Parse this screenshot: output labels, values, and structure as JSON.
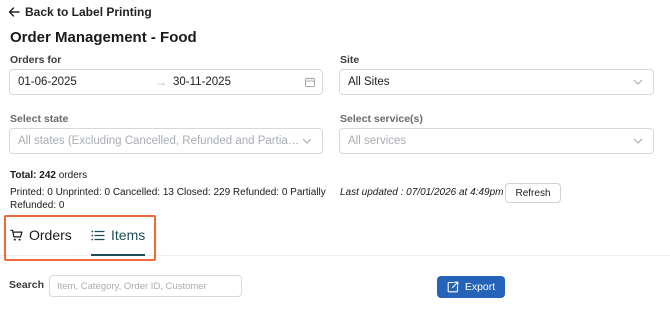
{
  "header": {
    "back_label": "Back to Label Printing",
    "title": "Order Management - Food"
  },
  "filters": {
    "orders_for_label": "Orders for",
    "date_start": "01-06-2025",
    "date_separator": "→",
    "date_end": "30-11-2025",
    "site_label": "Site",
    "site_value": "All Sites",
    "state_label": "Select state",
    "state_placeholder": "All states (Excluding Cancelled, Refunded and Partially ...",
    "service_label": "Select service(s)",
    "service_placeholder": "All services"
  },
  "summary": {
    "total_prefix": "Total:",
    "total_count": "242",
    "total_suffix": "orders",
    "breakdown_line1": "Printed: 0 Unprinted: 0 Cancelled: 13 Closed: 229 Refunded: 0 Partially",
    "breakdown_line2": "Refunded: 0",
    "last_updated": "Last updated : 07/01/2026 at 4:49pm",
    "refresh_label": "Refresh"
  },
  "tabs": [
    {
      "label": "Orders",
      "icon": "cart-icon",
      "active": false
    },
    {
      "label": "Items",
      "icon": "list-icon",
      "active": true
    }
  ],
  "toolbar": {
    "search_label": "Search",
    "search_placeholder": "Item, Category, Order ID, Customer",
    "export_label": "Export"
  },
  "colors": {
    "accent": "#1f4e5b",
    "primary_button": "#2563b8",
    "highlight_frame": "#ee6a3a"
  }
}
